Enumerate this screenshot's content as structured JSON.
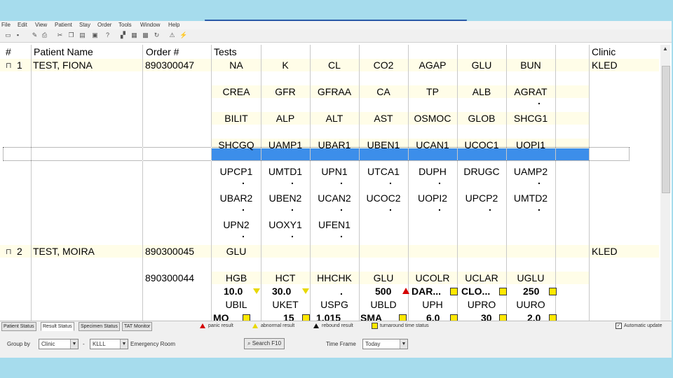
{
  "menu": [
    "File",
    "Edit",
    "View",
    "Patient",
    "Stay",
    "Order",
    "Tools",
    "Window",
    "Help"
  ],
  "columns": {
    "num": "#",
    "patient": "Patient Name",
    "order": "Order #",
    "tests": "Tests",
    "clinic": "Clinic"
  },
  "patients": [
    {
      "num": "1",
      "name": "TEST, FIONA",
      "order": "890300047",
      "clinic": "KLED"
    },
    {
      "num": "2",
      "name": "TEST, MOIRA",
      "order": "890300045",
      "clinic": "KLED"
    }
  ],
  "extra_order": "890300044",
  "test_rows": [
    [
      "NA",
      "K",
      "CL",
      "CO2",
      "AGAP",
      "GLU",
      "BUN"
    ],
    [
      "CREA",
      "GFR",
      "GFRAA",
      "CA",
      "TP",
      "ALB",
      "AGRAT"
    ],
    [
      "BILIT",
      "ALP",
      "ALT",
      "AST",
      "OSMOC",
      "GLOB",
      "SHCG1"
    ],
    [
      "SHCGQ",
      "UAMP1",
      "UBAR1",
      "UBEN1",
      "UCAN1",
      "UCOC1",
      "UOPI1"
    ],
    [
      "UPCP1",
      "UMTD1",
      "UPN1",
      "UTCA1",
      "DUPH",
      "DRUGC",
      "UAMP2"
    ],
    [
      "UBAR2",
      "UBEN2",
      "UCAN2",
      "UCOC2",
      "UOPI2",
      "UPCP2",
      "UMTD2"
    ],
    [
      "UPN2",
      "UOXY1",
      "UFEN1"
    ],
    [
      "GLU"
    ],
    [
      "HGB",
      "HCT",
      "HHCHK",
      "GLU",
      "UCOLR",
      "UCLAR",
      "UGLU"
    ],
    [
      "UBIL",
      "UKET",
      "USPG",
      "UBLD",
      "UPH",
      "UPRO",
      "UURO"
    ]
  ],
  "results_row": [
    "10.0",
    "30.0",
    ".",
    "500",
    "DAR...",
    "CLO...",
    "250"
  ],
  "cut_row": [
    "MO",
    "15",
    "1.015",
    "SMA",
    "6.0",
    "30",
    "2.0"
  ],
  "dot": ".",
  "tabs": [
    "Patient Status",
    "Result Status",
    "Specimen Status",
    "TAT Monitor"
  ],
  "legend": [
    "panic result",
    "abnormal result",
    "rebound result",
    "turnaround time status"
  ],
  "auto_update": "Automatic update",
  "filters": {
    "group_label": "Group by",
    "group_value": "Clinic",
    "dash": "-",
    "clinic_code": "KLLL",
    "clinic_name": "Emergency Room",
    "search_label": "Search F10",
    "timeframe_label": "Time Frame",
    "timeframe_value": "Today"
  },
  "colors": {
    "selection": "#3c8eea",
    "row_highlight": "#fffde8",
    "panic": "#d40000",
    "abnormal": "#e8d800",
    "rebound": "#111111"
  }
}
